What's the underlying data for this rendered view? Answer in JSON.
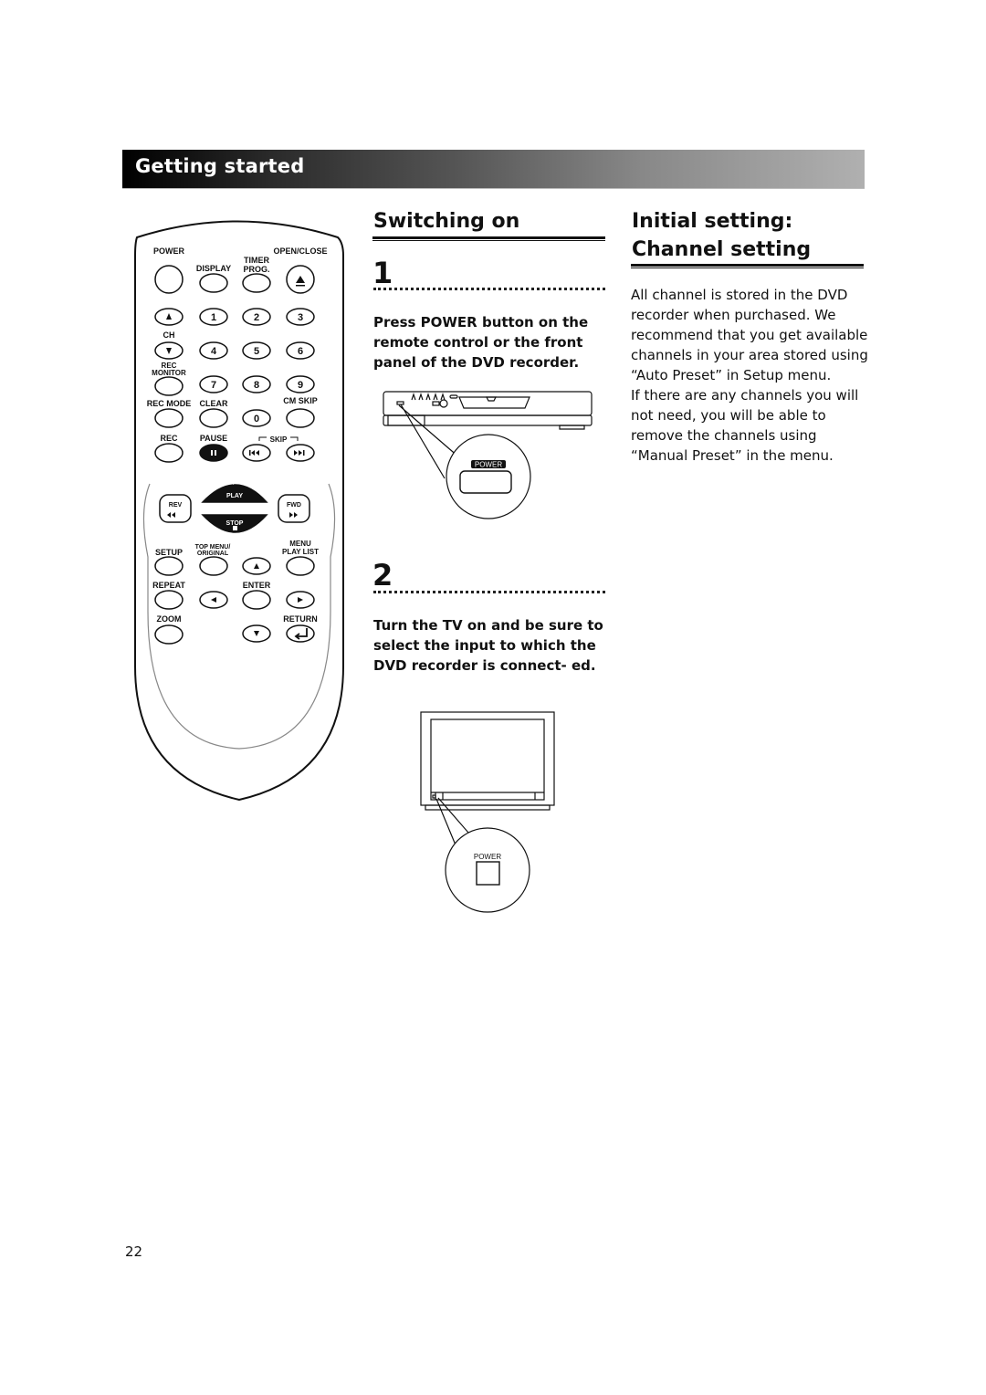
{
  "header": {
    "section_title": "Getting started"
  },
  "remote": {
    "labels": {
      "power": "POWER",
      "display": "DISPLAY",
      "timer_prog_1": "TIMER",
      "timer_prog_2": "PROG.",
      "open_close": "OPEN/CLOSE",
      "ch": "CH",
      "rec_monitor_1": "REC",
      "rec_monitor_2": "MONITOR",
      "rec_mode": "REC MODE",
      "clear": "CLEAR",
      "cm_skip": "CM SKIP",
      "rec": "REC",
      "pause": "PAUSE",
      "skip": "SKIP",
      "play": "PLAY",
      "rev": "REV",
      "fwd": "FWD",
      "stop": "STOP",
      "setup": "SETUP",
      "top_menu_1": "TOP MENU/",
      "top_menu_2": "ORIGINAL",
      "menu_1": "MENU",
      "menu_2": "PLAY LIST",
      "repeat": "REPEAT",
      "enter": "ENTER",
      "zoom": "ZOOM",
      "return": "RETURN"
    },
    "digits": [
      "1",
      "2",
      "3",
      "4",
      "5",
      "6",
      "7",
      "8",
      "9",
      "0"
    ],
    "icons": [
      "eject-icon",
      "channel-up-icon",
      "channel-down-icon",
      "pause-icon",
      "skip-back-icon",
      "skip-forward-icon",
      "play-icon",
      "stop-icon",
      "rewind-icon",
      "fast-forward-icon",
      "arrow-up-icon",
      "arrow-left-icon",
      "arrow-right-icon",
      "arrow-down-icon",
      "return-icon"
    ]
  },
  "switching_on": {
    "title": "Switching on",
    "steps": [
      {
        "number": "1",
        "text": "Press POWER button on the remote control or the front panel of the DVD recorder.",
        "callout_label": "POWER"
      },
      {
        "number": "2",
        "text": "Turn the TV on and be sure to select the input to which the DVD recorder is connect- ed.",
        "callout_label": "POWER"
      }
    ]
  },
  "channel_setting": {
    "title_line1": "Initial setting:",
    "title_line2": "Channel setting",
    "paragraph1": "All channel is stored in the DVD recorder when purchased. We recommend that you get available channels in your area stored using “Auto Preset” in Setup menu.",
    "paragraph2": "If there are any channels you will not need, you will be able to remove the channels using “Manual Preset” in the menu."
  },
  "footer": {
    "page_number": "22"
  }
}
